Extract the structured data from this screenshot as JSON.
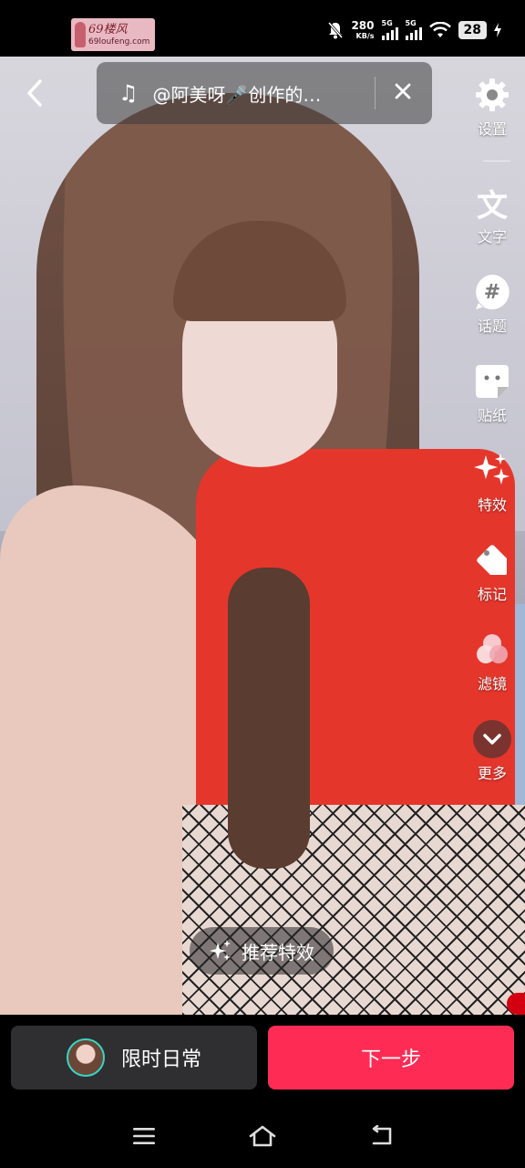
{
  "status_bar": {
    "watermark_title": "69楼风",
    "watermark_site": "69loufeng.com",
    "net_speed": "280",
    "net_unit": "KB/s",
    "sim1_label": "5G",
    "sim2_label": "5G",
    "battery": "28"
  },
  "top_bar": {
    "music_title": "@阿美呀🎤创作的…"
  },
  "toolbar": {
    "settings": "设置",
    "text": "文字",
    "topic": "话题",
    "sticker": "贴纸",
    "effects": "特效",
    "tag": "标记",
    "filter": "滤镜",
    "more": "更多"
  },
  "recommend_effects": "推荐特效",
  "bottom": {
    "daily_label": "限时日常",
    "next_label": "下一步"
  }
}
